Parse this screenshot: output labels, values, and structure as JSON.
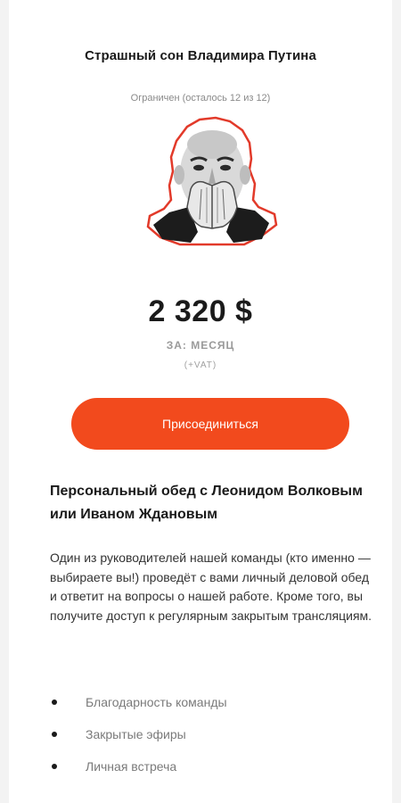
{
  "tier": {
    "title": "Страшный сон Владимира Путина",
    "limit": "Ограничен (осталось 12 из 12)",
    "price": "2 320 $",
    "period": "ЗА: МЕСЯЦ",
    "vat": "(+VAT)",
    "join_label": "Присоединиться",
    "accent_color": "#f24a1d"
  },
  "perk": {
    "heading": "Персональный обед с Леонидом Волковым или Иваном Ждановым",
    "description": "Один из руководителей нашей команды (кто именно — выбираете вы!) проведёт с вами личный деловой обед и ответит на вопросы о нашей работе. Кроме того, вы получите доступ к регулярным закрытым трансляциям.",
    "items": [
      {
        "label": "Благодарность команды"
      },
      {
        "label": "Закрытые эфиры"
      },
      {
        "label": "Личная встреча"
      }
    ]
  }
}
